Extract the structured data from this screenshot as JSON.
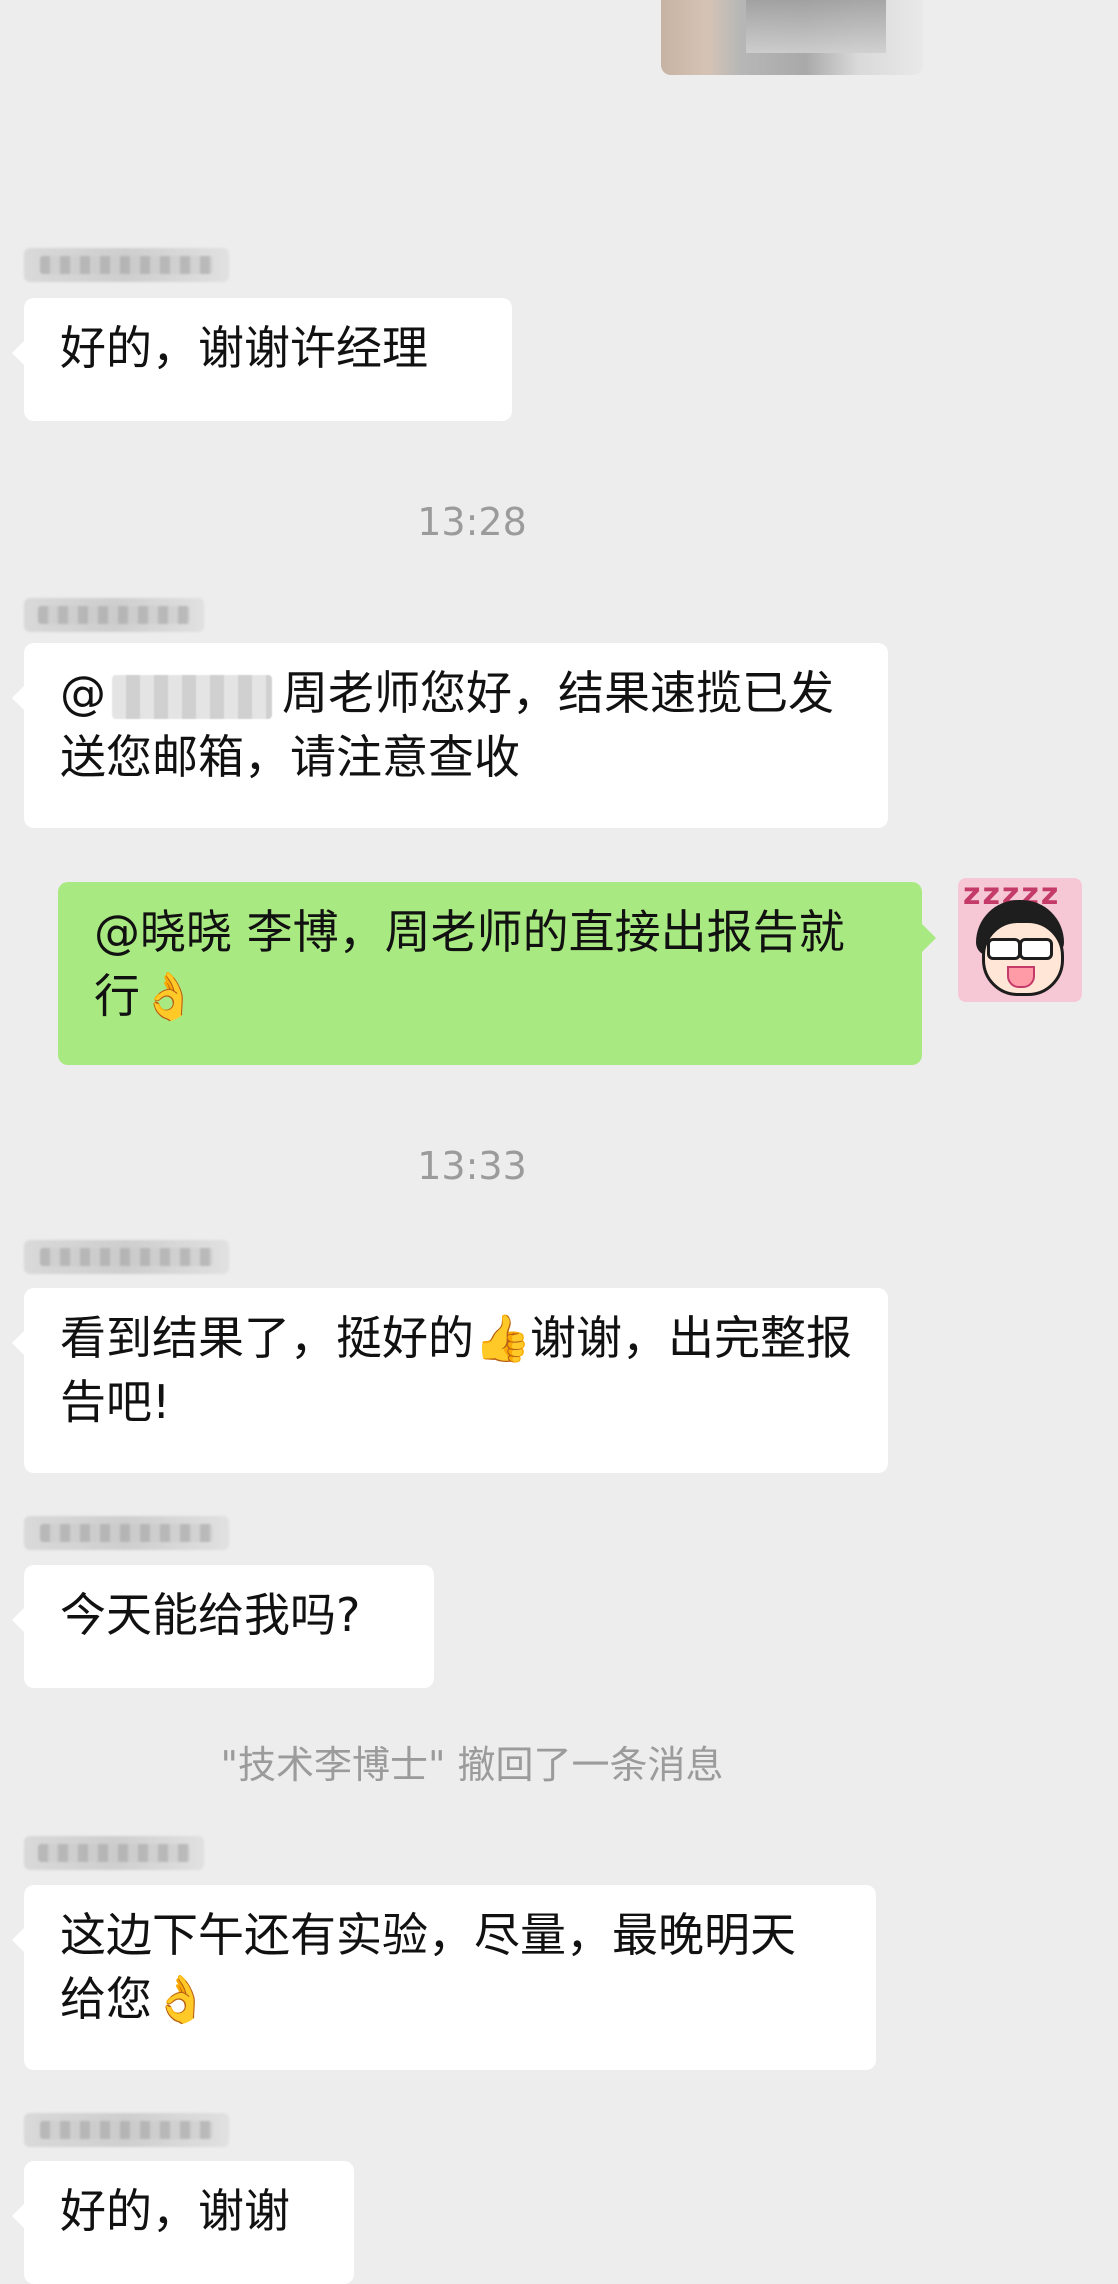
{
  "top_image": {
    "label": ""
  },
  "messages": [
    {
      "type": "incoming",
      "sender": "",
      "text": "好的，谢谢许经理"
    },
    {
      "type": "timestamp",
      "text": "13:28"
    },
    {
      "type": "incoming",
      "sender": "",
      "mention_prefix": "@",
      "mention_target": "",
      "text": "周老师您好，结果速揽已发送您邮箱，请注意查收"
    },
    {
      "type": "outgoing",
      "text": "@晓晓 李博，周老师的直接出报告就行",
      "emoji": "👌"
    },
    {
      "type": "timestamp",
      "text": "13:33"
    },
    {
      "type": "incoming",
      "sender": "",
      "text_before": "看到结果了，挺好的",
      "emoji": "👍",
      "text_after": "谢谢，出完整报告吧!"
    },
    {
      "type": "incoming",
      "sender": "",
      "text": "今天能给我吗?"
    },
    {
      "type": "recall",
      "text": "\"技术李博士\" 撤回了一条消息"
    },
    {
      "type": "incoming",
      "sender": "",
      "text": "这边下午还有实验，尽量，最晚明天给您",
      "emoji": "👌"
    },
    {
      "type": "incoming",
      "sender": "",
      "text": "好的，谢谢"
    }
  ],
  "colors": {
    "background": "#ededed",
    "incoming_bubble": "#ffffff",
    "outgoing_bubble": "#a9e981",
    "meta_text": "#9b9b9b"
  },
  "icons": {
    "avatar": "cartoon-girl-avatar",
    "ok_hand": "ok-hand-emoji",
    "thumbs_up": "thumbs-up-emoji"
  }
}
